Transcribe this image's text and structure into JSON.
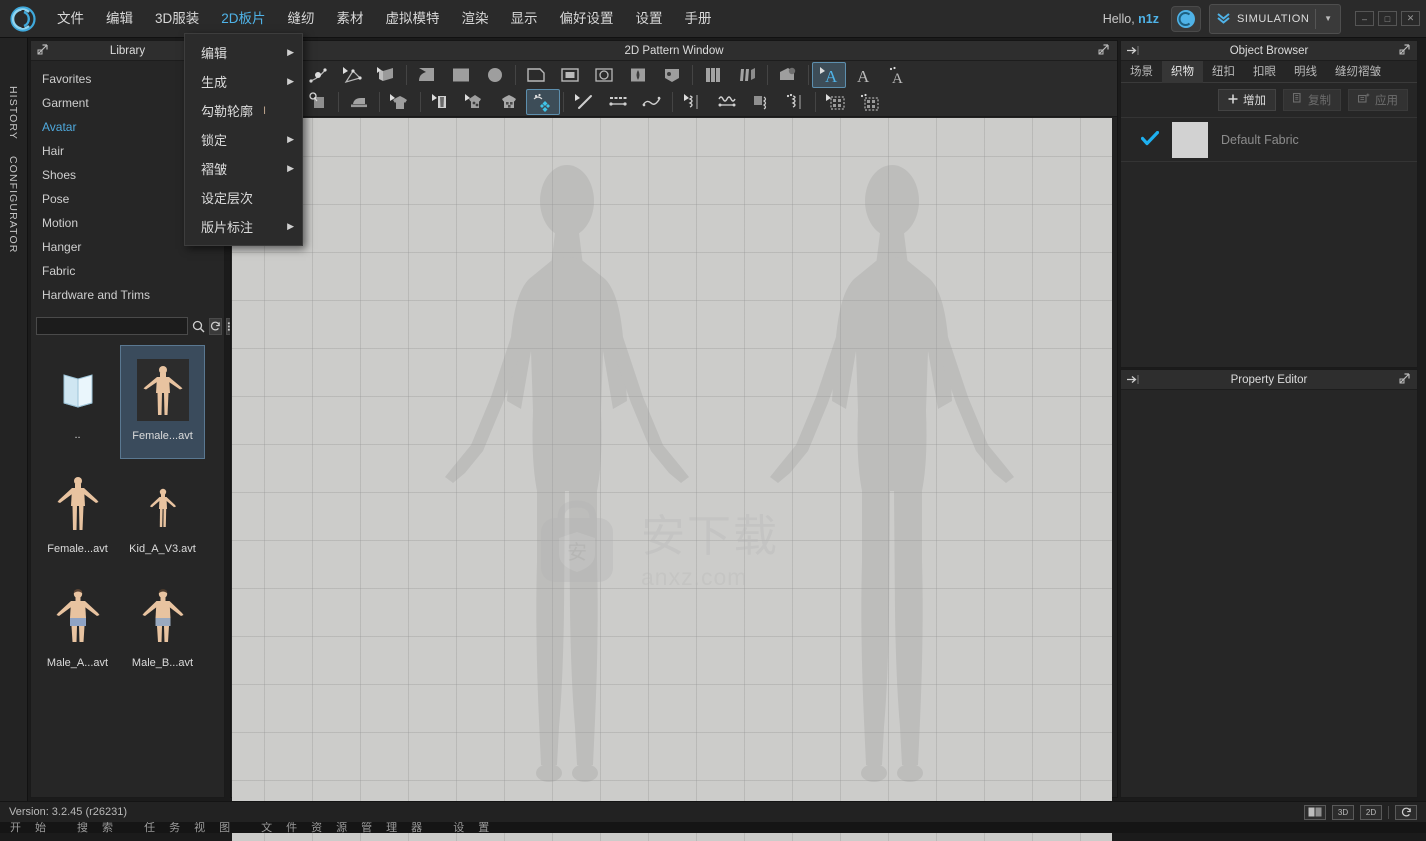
{
  "app": {
    "logo_icon": "clo-logo-icon",
    "version_text": "Version: 3.2.45    (r26231)",
    "taskbar_text": "开始   搜索   任务视图   文件资源管理器   设置"
  },
  "menubar": {
    "items": [
      {
        "label": "文件",
        "name": "menu-file"
      },
      {
        "label": "编辑",
        "name": "menu-edit"
      },
      {
        "label": "3D服装",
        "name": "menu-3d-garment"
      },
      {
        "label": "2D板片",
        "name": "menu-2d-pattern",
        "active": true
      },
      {
        "label": "缝纫",
        "name": "menu-sewing"
      },
      {
        "label": "素材",
        "name": "menu-material"
      },
      {
        "label": "虚拟模特",
        "name": "menu-avatar"
      },
      {
        "label": "渲染",
        "name": "menu-render"
      },
      {
        "label": "显示",
        "name": "menu-display"
      },
      {
        "label": "偏好设置",
        "name": "menu-preferences"
      },
      {
        "label": "设置",
        "name": "menu-settings"
      },
      {
        "label": "手册",
        "name": "menu-manual"
      }
    ],
    "hello_prefix": "Hello,",
    "user_name": "n1z",
    "cloud_icon": "cloud-icon",
    "mode_label": "SIMULATION",
    "mode_icon": "double-chevron-down-icon",
    "mode_caret": "▼",
    "win_minimize": "–",
    "win_maximize": "□",
    "win_close": "✕"
  },
  "dropdown": {
    "items": [
      {
        "label": "编辑",
        "shortcut": "",
        "submenu": true
      },
      {
        "label": "生成",
        "shortcut": "",
        "submenu": true
      },
      {
        "label": "勾勒轮廓",
        "shortcut": "I",
        "submenu": false
      },
      {
        "label": "锁定",
        "shortcut": "",
        "submenu": true
      },
      {
        "label": "褶皱",
        "shortcut": "",
        "submenu": true
      },
      {
        "label": "设定层次",
        "shortcut": "",
        "submenu": false
      },
      {
        "label": "版片标注",
        "shortcut": "",
        "submenu": true
      }
    ],
    "arrow_glyph": "▶"
  },
  "vertical_tabs": [
    {
      "label": "HISTORY",
      "name": "vtab-history"
    },
    {
      "label": "CONFIGURATOR",
      "name": "vtab-configurator"
    }
  ],
  "library": {
    "title": "Library",
    "popout_icon": "popout-icon",
    "categories": [
      {
        "label": "Favorites"
      },
      {
        "label": "Garment"
      },
      {
        "label": "Avatar",
        "selected": true
      },
      {
        "label": "Hair"
      },
      {
        "label": "Shoes"
      },
      {
        "label": "Pose"
      },
      {
        "label": "Motion"
      },
      {
        "label": "Hanger"
      },
      {
        "label": "Fabric"
      },
      {
        "label": "Hardware and Trims"
      }
    ],
    "search_value": "",
    "search_placeholder": "",
    "search_icon": "search-icon",
    "refresh_icon": "refresh-icon",
    "list-view_icon": "list-view-icon",
    "files": [
      {
        "name": "..",
        "thumb": "folder-up-icon",
        "selected": false
      },
      {
        "name": "Female...avt",
        "thumb": "avatar-female-icon",
        "selected": true
      },
      {
        "name": "Female...avt",
        "thumb": "avatar-female-icon",
        "selected": false
      },
      {
        "name": "Kid_A_V3.avt",
        "thumb": "avatar-kid-icon",
        "selected": false
      },
      {
        "name": "Male_A...avt",
        "thumb": "avatar-male-icon",
        "selected": false
      },
      {
        "name": "Male_B...avt",
        "thumb": "avatar-male-icon",
        "selected": false
      }
    ]
  },
  "pattern_window": {
    "title": "2D Pattern Window",
    "popout_icon": "popout-icon",
    "watermark_text": "安下载",
    "watermark_sub": "anxz.com",
    "watermark_icon": "shield-bag-icon",
    "toolbar_row1": [
      "edit-curve-point-tool",
      "edit-curve-tool",
      "add-point-tool",
      "edit-polyline-tool",
      "fold-arrange-tool",
      "sep",
      "polygon-tool",
      "rectangle-tool",
      "circle-tool",
      "sep",
      "trace-pattern-tool",
      "inner-rectangle-tool",
      "inner-circle-tool",
      "dart-tool",
      "notch-tool",
      "sep",
      "pleat-tool",
      "sep",
      "fold-tool",
      "gather-tool",
      "sep",
      "texture-tool",
      "sep",
      "select-text-tool",
      "text-tool",
      "edit-text-tool"
    ],
    "toolbar_row2": [
      "sew-segment-tool",
      "free-sew-tool",
      "sew-zoom-tool",
      "sep",
      "flatten-tool",
      "sep",
      "pattern-3d-tool",
      "sep",
      "layer-tool",
      "grading-tool",
      "checker-tool",
      "pattern-move-tool",
      "sep",
      "line-measure-tool",
      "dotted-measure-tool",
      "curve-measure-tool",
      "sep",
      "pleat-edit-tool",
      "elastic-tool",
      "shirring-tool",
      "zigzag-tool",
      "sep",
      "select-mesh-tool",
      "edit-mesh-tool"
    ]
  },
  "object_browser": {
    "title": "Object Browser",
    "pin_icon": "pin-arrow-icon",
    "popout_icon": "popout-icon",
    "tabs": [
      {
        "label": "场景",
        "active": false
      },
      {
        "label": "织物",
        "active": true
      },
      {
        "label": "纽扣",
        "active": false
      },
      {
        "label": "扣眼",
        "active": false
      },
      {
        "label": "明线",
        "active": false
      },
      {
        "label": "缝纫褶皱",
        "active": false
      }
    ],
    "actions": [
      {
        "label": "增加",
        "icon": "plus-icon",
        "disabled": false
      },
      {
        "label": "复制",
        "icon": "copy-icon",
        "disabled": true
      },
      {
        "label": "应用",
        "icon": "apply-icon",
        "disabled": true
      }
    ],
    "fabric_row": {
      "checked": true,
      "check_icon": "check-icon",
      "swatch_color": "#d2d2d2",
      "name": "Default Fabric"
    }
  },
  "property_editor": {
    "title": "Property Editor",
    "pin_icon": "pin-arrow-icon",
    "popout_icon": "popout-icon"
  },
  "statusbar": {
    "view_buttons": [
      {
        "label": "",
        "name": "split-view-button",
        "icon": "split-view-icon"
      },
      {
        "label": "3D",
        "name": "view-3d-button"
      },
      {
        "label": "2D",
        "name": "view-2d-button"
      },
      {
        "label": "",
        "name": "reset-view-button",
        "icon": "refresh-icon"
      }
    ]
  },
  "colors": {
    "accent": "#4fb3e8",
    "panel_bg": "#262626",
    "menubar_bg": "#2a2a2a",
    "canvas_bg": "#ccccca",
    "selection_bg": "#3a4b5c"
  }
}
